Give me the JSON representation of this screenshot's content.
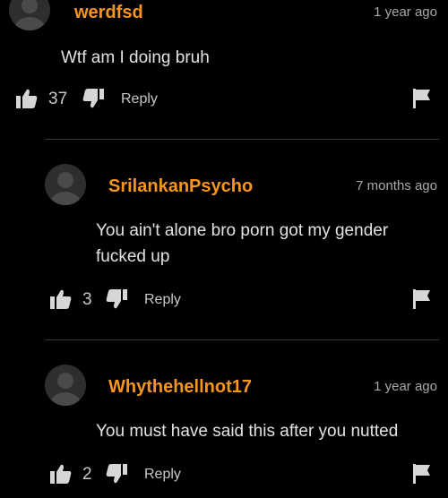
{
  "comments": [
    {
      "username": "werdfsd",
      "time": "1 year ago",
      "body": "Wtf am I doing bruh",
      "likes": "37",
      "reply_label": "Reply"
    },
    {
      "username": "SrilankanPsycho",
      "time": "7 months ago",
      "body": "You ain't alone bro porn got my gender fucked up",
      "likes": "3",
      "reply_label": "Reply"
    },
    {
      "username": "Whythehellnot17",
      "time": "1 year ago",
      "body": "You must have said this after you nutted",
      "likes": "2",
      "reply_label": "Reply"
    }
  ],
  "colors": {
    "background": "#000000",
    "username": "#f7951d",
    "text": "#e3e3e3",
    "meta": "#a9a9a9",
    "divider": "#3a3a3a"
  },
  "icons": [
    "avatar",
    "thumbs-up-icon",
    "thumbs-down-icon",
    "flag-icon"
  ]
}
